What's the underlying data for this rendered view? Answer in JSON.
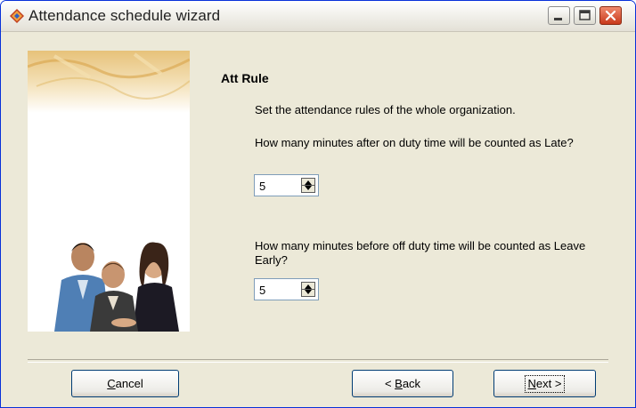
{
  "window": {
    "title": "Attendance schedule wizard"
  },
  "content": {
    "heading": "Att Rule",
    "description": "Set the attendance rules of the whole organization.",
    "late_question": "How many minutes after on duty time will be counted as Late?",
    "late_value": "5",
    "leave_early_question": "How many minutes before off duty time will be counted as Leave Early?",
    "leave_early_value": "5"
  },
  "buttons": {
    "cancel_mnemonic": "C",
    "cancel_rest": "ancel",
    "back_prefix": "< ",
    "back_mnemonic": "B",
    "back_rest": "ack",
    "next_mnemonic": "N",
    "next_rest": "ext >"
  },
  "icons": {
    "app": "wizard-app-icon",
    "minimize": "minimize-icon",
    "maximize": "maximize-icon",
    "close": "close-icon",
    "spin_up": "arrow-up-icon",
    "spin_down": "arrow-down-icon"
  },
  "colors": {
    "dialog_bg": "#ece9d8",
    "close_button": "#c8391b",
    "field_border": "#7f9db9"
  }
}
